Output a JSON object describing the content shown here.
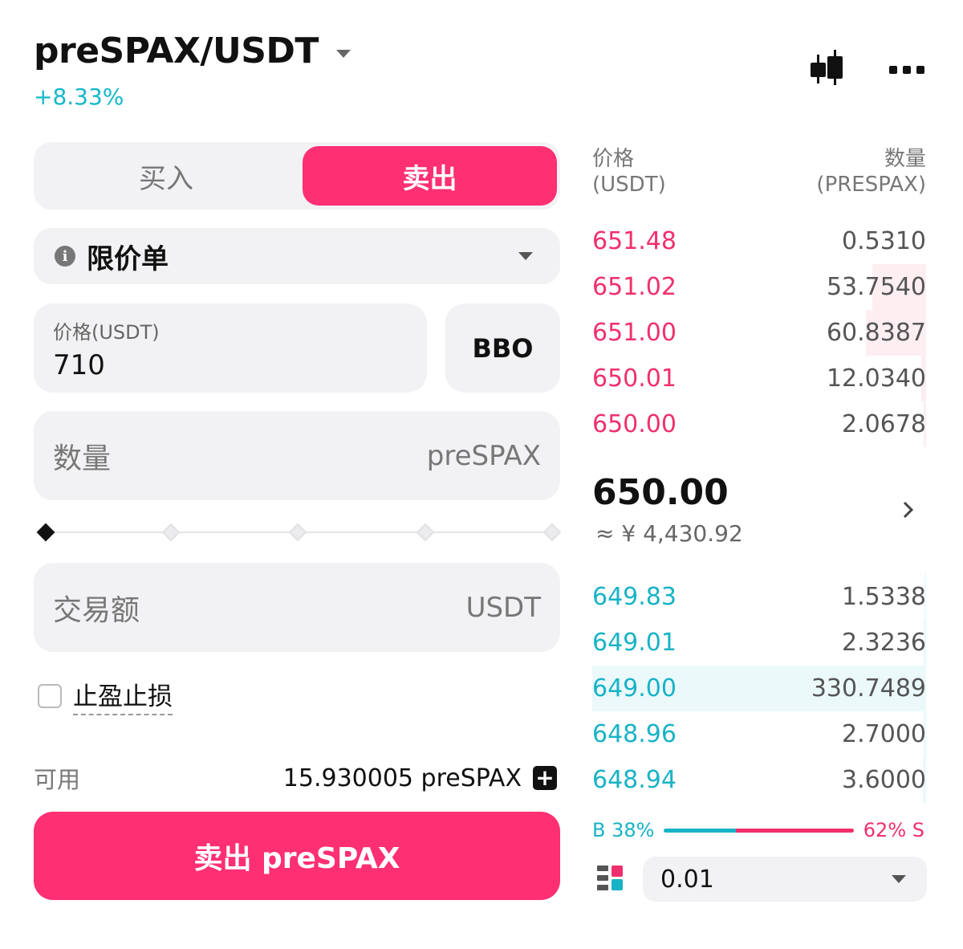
{
  "header": {
    "pair": "preSPAX/USDT",
    "change": "+8.33%",
    "icons": [
      "candlestick-chart-icon",
      "more-icon"
    ]
  },
  "order_form": {
    "tabs": {
      "buy": "买入",
      "sell": "卖出",
      "active": "sell"
    },
    "order_type": "限价单",
    "price": {
      "label": "价格(USDT)",
      "value": "710"
    },
    "bbo_label": "BBO",
    "quantity": {
      "label": "数量",
      "unit": "preSPAX"
    },
    "amount": {
      "label": "交易额",
      "unit": "USDT"
    },
    "slider": {
      "steps": 5,
      "selected_index": 0,
      "value_percent": 0
    },
    "tpsl": {
      "label": "止盈止损",
      "checked": false
    },
    "available": {
      "label": "可用",
      "value": "15.930005 preSPAX"
    },
    "submit_label": "卖出 preSPAX"
  },
  "orderbook": {
    "header": {
      "price_label": "价格",
      "price_unit": "(USDT)",
      "qty_label": "数量",
      "qty_unit": "(PRESPAX)"
    },
    "asks": [
      {
        "price": "651.48",
        "qty": "0.5310",
        "depth": 0
      },
      {
        "price": "651.02",
        "qty": "53.7540",
        "depth": 0.16
      },
      {
        "price": "651.00",
        "qty": "60.8387",
        "depth": 0.18
      },
      {
        "price": "650.01",
        "qty": "12.0340",
        "depth": 0.015
      },
      {
        "price": "650.00",
        "qty": "2.0678",
        "depth": 0.008
      }
    ],
    "last_price": "650.00",
    "fiat_price": "≈ ¥ 4,430.92",
    "bids": [
      {
        "price": "649.83",
        "qty": "1.5338",
        "depth": 0.005
      },
      {
        "price": "649.01",
        "qty": "2.3236",
        "depth": 0.007
      },
      {
        "price": "649.00",
        "qty": "330.7489",
        "depth": 1.0
      },
      {
        "price": "648.96",
        "qty": "2.7000",
        "depth": 0.008
      },
      {
        "price": "648.94",
        "qty": "3.6000",
        "depth": 0.01
      }
    ],
    "ratio": {
      "buy_label": "B 38%",
      "sell_label": "62% S",
      "buy_percent": 38,
      "sell_percent": 62
    },
    "precision": "0.01"
  },
  "colors": {
    "sell": "#fe2f72",
    "ask_text": "#f0306c",
    "bid_text": "#18b3c6",
    "positive": "#14b8c9"
  }
}
